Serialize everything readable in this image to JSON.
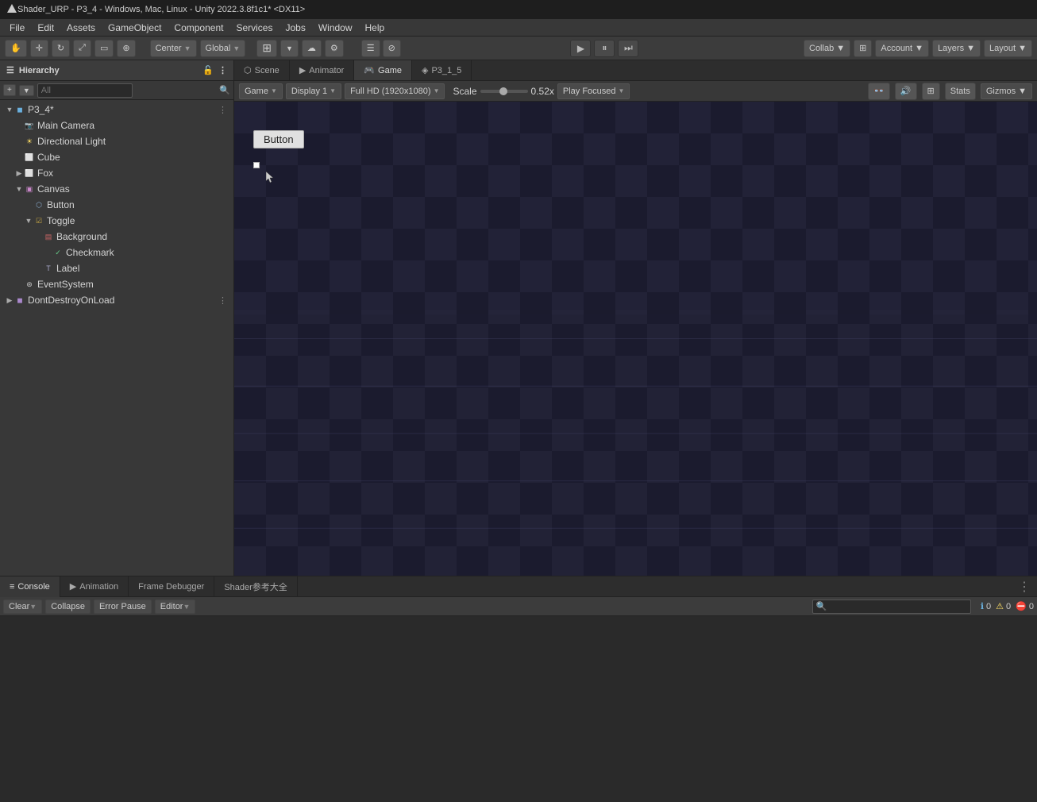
{
  "window": {
    "title": "Shader_URP - P3_4 - Windows, Mac, Linux - Unity 2022.3.8f1c1* <DX11>"
  },
  "menu": {
    "items": [
      "File",
      "Edit",
      "Assets",
      "GameObject",
      "Component",
      "Services",
      "Jobs",
      "Window",
      "Help"
    ]
  },
  "toolbar": {
    "play_label": "▶",
    "pause_label": "⏸",
    "step_label": "⏭",
    "center_label": "Center",
    "global_label": "Global"
  },
  "hierarchy": {
    "title": "Hierarchy",
    "search_placeholder": "All",
    "root": "P3_4*",
    "items": [
      {
        "label": "P3_4*",
        "depth": 0,
        "has_arrow": true,
        "arrow_open": true,
        "icon": "cube",
        "is_root": true
      },
      {
        "label": "Main Camera",
        "depth": 1,
        "has_arrow": false,
        "icon": "camera"
      },
      {
        "label": "Directional Light",
        "depth": 1,
        "has_arrow": false,
        "icon": "light"
      },
      {
        "label": "Cube",
        "depth": 1,
        "has_arrow": false,
        "icon": "cube"
      },
      {
        "label": "Fox",
        "depth": 1,
        "has_arrow": true,
        "arrow_open": false,
        "icon": "cube"
      },
      {
        "label": "Canvas",
        "depth": 1,
        "has_arrow": true,
        "arrow_open": true,
        "icon": "canvas"
      },
      {
        "label": "Button",
        "depth": 2,
        "has_arrow": false,
        "icon": "button"
      },
      {
        "label": "Toggle",
        "depth": 2,
        "has_arrow": true,
        "arrow_open": true,
        "icon": "toggle"
      },
      {
        "label": "Background",
        "depth": 3,
        "has_arrow": false,
        "icon": "bg"
      },
      {
        "label": "Checkmark",
        "depth": 4,
        "has_arrow": false,
        "icon": "check"
      },
      {
        "label": "Label",
        "depth": 3,
        "has_arrow": false,
        "icon": "label"
      },
      {
        "label": "EventSystem",
        "depth": 1,
        "has_arrow": false,
        "icon": "event"
      },
      {
        "label": "DontDestroyOnLoad",
        "depth": 0,
        "has_arrow": true,
        "arrow_open": false,
        "icon": "dontdestroy"
      }
    ]
  },
  "view_tabs": {
    "tabs": [
      {
        "label": "Scene",
        "icon": "⬡",
        "active": false
      },
      {
        "label": "Animator",
        "icon": "▶",
        "active": false
      },
      {
        "label": "Game",
        "icon": "🎮",
        "active": true
      },
      {
        "label": "P3_1_5",
        "icon": "◈",
        "active": false
      }
    ]
  },
  "game_toolbar": {
    "game_label": "Game",
    "display_label": "Display 1",
    "resolution_label": "Full HD (1920x1080)",
    "scale_label": "Scale",
    "scale_value": "0.52x",
    "play_focused_label": "Play Focused",
    "stats_label": "Stats",
    "gizmos_label": "Gizmos"
  },
  "game_view": {
    "button_label": "Button"
  },
  "bottom_panel": {
    "tabs": [
      {
        "label": "Console",
        "icon": "≡",
        "active": true
      },
      {
        "label": "Animation",
        "icon": "▶",
        "active": false
      },
      {
        "label": "Frame Debugger",
        "active": false
      },
      {
        "label": "Shader参考大全",
        "active": false
      }
    ],
    "console_toolbar": {
      "clear_label": "Clear",
      "collapse_label": "Collapse",
      "error_pause_label": "Error Pause",
      "editor_label": "Editor",
      "search_placeholder": "🔍",
      "count_info": "0",
      "count_warn": "0",
      "count_error": "0"
    }
  }
}
